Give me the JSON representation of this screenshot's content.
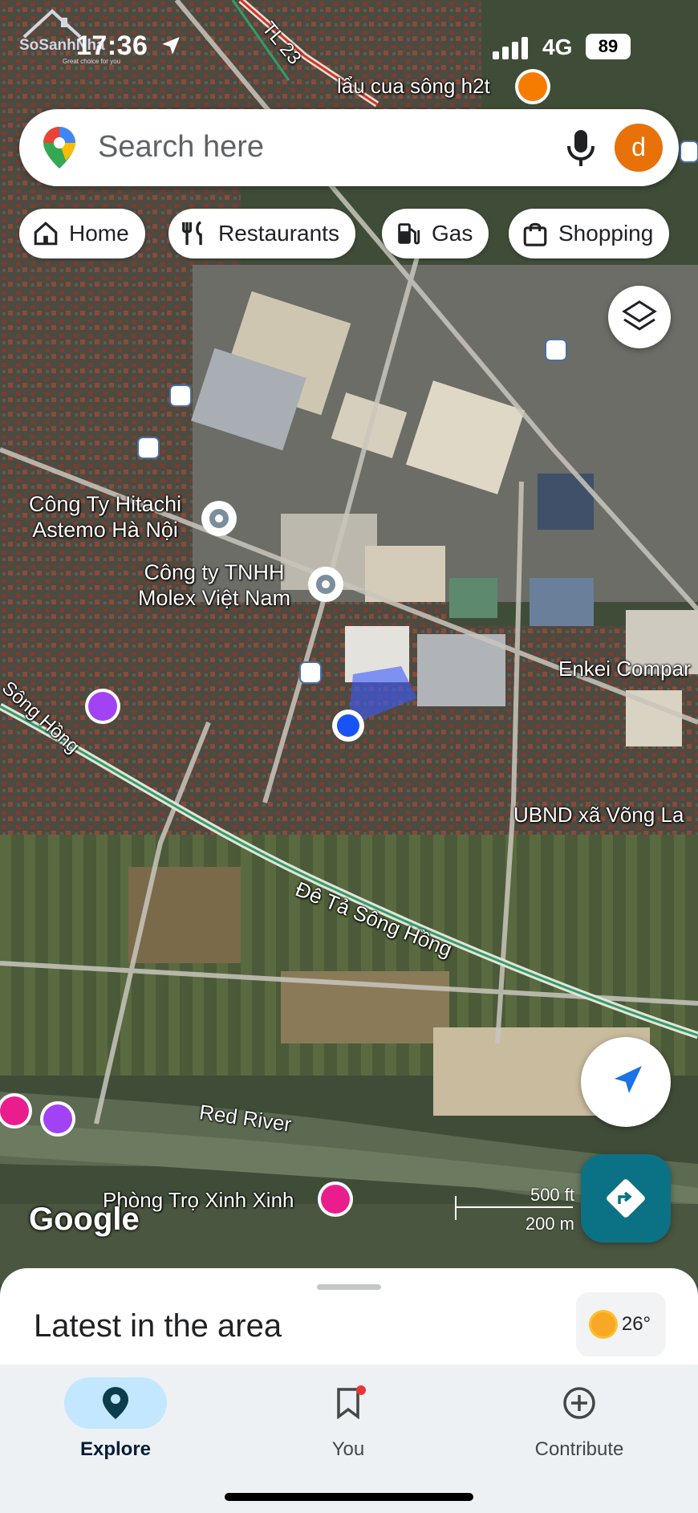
{
  "status_bar": {
    "time": "17:36",
    "network": "4G",
    "battery": "89"
  },
  "watermark": {
    "text": "SoSanhNha",
    "subtext": "Great choice for you"
  },
  "search": {
    "placeholder": "Search here",
    "avatar_letter": "d"
  },
  "chips": [
    {
      "label": "Home",
      "icon": "home-icon"
    },
    {
      "label": "Restaurants",
      "icon": "fork-knife-icon"
    },
    {
      "label": "Gas",
      "icon": "gas-pump-icon"
    },
    {
      "label": "Shopping",
      "icon": "shopping-bag-icon"
    }
  ],
  "map": {
    "labels": {
      "road_tl23": "TL 23",
      "lau_cua": "lẩu cua sông h2t",
      "hitachi": "Công Ty Hitachi\nAstemo Hà Nội",
      "molex": "Công ty TNHH\nMolex Việt Nam",
      "enkei": "Enkei Compar",
      "song_hong": "Sông Hồng",
      "ubnd": "UBND xã Võng La",
      "de_ta": "Đê Tả Sông Hồng",
      "red_river": "Red River",
      "phong_tro": "Phòng Trọ Xinh Xinh"
    },
    "logo": "Google",
    "scale_ft": "500 ft",
    "scale_m": "200 m"
  },
  "sheet": {
    "title": "Latest in the area",
    "temperature": "26°"
  },
  "nav": [
    {
      "label": "Explore",
      "icon": "explore-pin-icon",
      "active": true
    },
    {
      "label": "You",
      "icon": "bookmark-icon",
      "active": false
    },
    {
      "label": "Contribute",
      "icon": "add-circle-icon",
      "active": false
    }
  ],
  "colors": {
    "accent": "#1a73e8",
    "avatar": "#e8710a",
    "directions": "#0b7285",
    "active_nav": "#c2e7ff"
  }
}
